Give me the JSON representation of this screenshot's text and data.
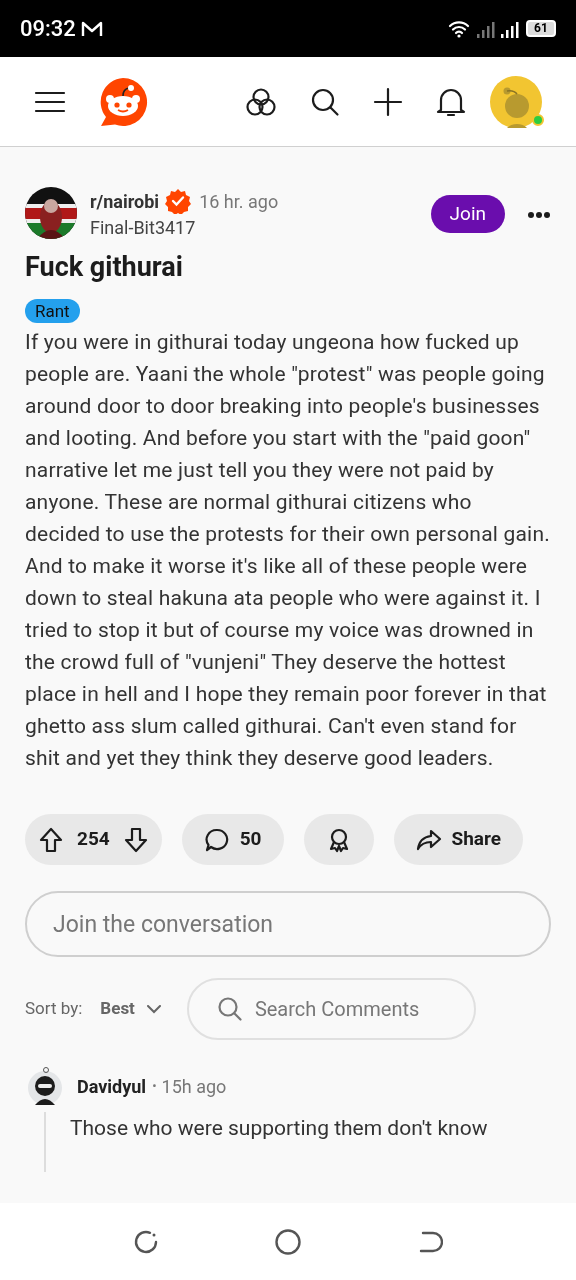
{
  "status_bar": {
    "time": "09:32",
    "battery": "61"
  },
  "post": {
    "subreddit": "r/nairobi",
    "time": "16 hr. ago",
    "author": "Final-Bit3417",
    "join_label": "Join",
    "title": "Fuck githurai",
    "flair": "Rant",
    "body": "If you were in githurai today ungeona how fucked up people are. Yaani the whole \"protest\" was people going around door to door breaking into people's businesses and looting. And before you start with the \"paid goon\" narrative let me just tell you they were not paid by anyone. These are normal githurai citizens who decided to use the protests for their own personal gain. And to make it worse it's like all of these people were down to steal hakuna ata people who were against it. I tried to stop it but of course my voice was drowned in the crowd full of \"vunjeni\" They deserve the hottest place in hell and I hope they remain poor forever in that ghetto ass slum called githurai. Can't even stand for shit and yet they think they deserve good leaders.",
    "votes": "254",
    "comments": "50",
    "share_label": "Share"
  },
  "comment_field": {
    "placeholder": "Join the conversation"
  },
  "sort": {
    "label": "Sort by:",
    "value": "Best"
  },
  "comment_search": {
    "placeholder": "Search Comments"
  },
  "comments": [
    {
      "author": "Davidyul",
      "separator": "•",
      "time": "15h ago",
      "text": "Those who were supporting them don't know"
    }
  ]
}
